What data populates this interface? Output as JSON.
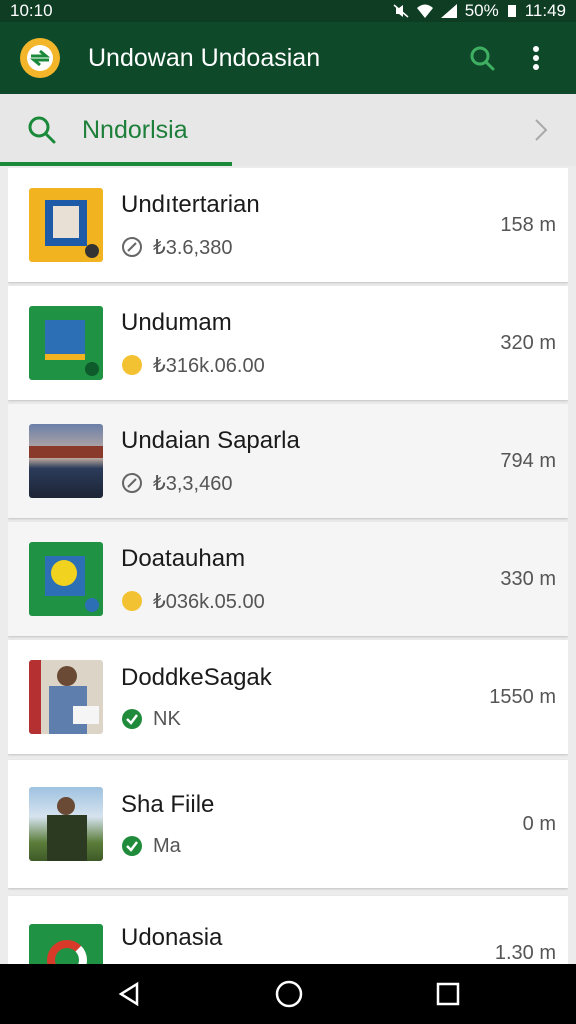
{
  "status_bar": {
    "time": "10:10",
    "battery": "50%",
    "clock": "11:49"
  },
  "app_bar": {
    "title": "Undowan Undoasian"
  },
  "search": {
    "query": "Nndorlsia"
  },
  "list": [
    {
      "name": "Undıtertarian",
      "meta": "₺3.6,380",
      "meta_icon": "compass-icon",
      "distance": "158 m"
    },
    {
      "name": "Undumam",
      "meta": "₺316k.06.00",
      "meta_icon": "coin-icon",
      "distance": "320 m"
    },
    {
      "name": "Undaian Saparla",
      "meta": "₺3,3,460",
      "meta_icon": "compass-icon",
      "distance": "794 m"
    },
    {
      "name": "Doatauham",
      "meta": "₺036k.05.00",
      "meta_icon": "coin-icon",
      "distance": "330 m"
    },
    {
      "name": "DoddkeSagak",
      "meta": "NK",
      "meta_icon": "check-icon",
      "distance": "1550 m"
    },
    {
      "name": "Sha Fiile",
      "meta": "Ma",
      "meta_icon": "check-icon",
      "distance": "0 m"
    },
    {
      "name": "Udonasia",
      "meta": "",
      "meta_icon": "",
      "distance": "1.30 m"
    }
  ],
  "colors": {
    "primary_dark": "#0e3d24",
    "primary": "#0e4a2a",
    "accent": "#1a8a3a",
    "coin": "#f3c232",
    "check": "#1f8b3b"
  }
}
